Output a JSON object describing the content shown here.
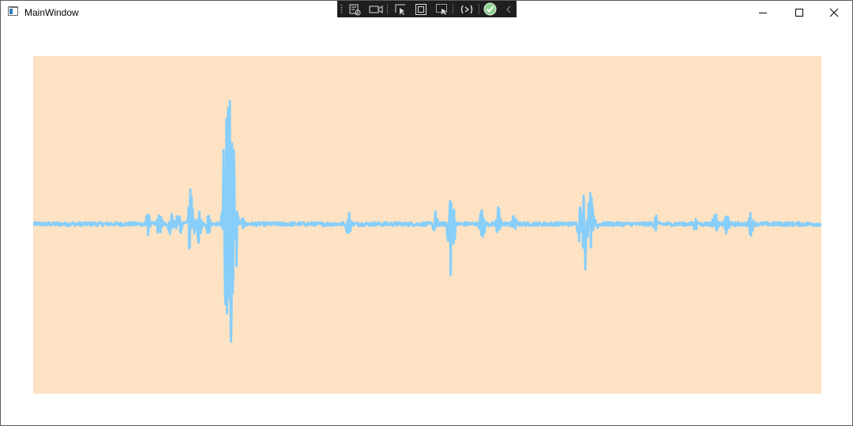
{
  "window": {
    "title": "MainWindow"
  },
  "caption_buttons": {
    "minimize_icon": "minimize-icon",
    "maximize_icon": "maximize-icon",
    "close_icon": "close-icon"
  },
  "debug_toolbar": {
    "items": [
      "live-visual-tree-icon",
      "camera-icon",
      "select-element-icon",
      "display-layout-adorners-icon",
      "track-focus-icon",
      "hot-reload-icon",
      "hot-reload-ok-icon",
      "collapse-chevron-icon"
    ]
  },
  "colors": {
    "plot_background": "#fde3c3",
    "waveform": "#87cefa",
    "window_background": "#ffffff"
  },
  "chart_data": {
    "type": "line",
    "title": "",
    "xlabel": "",
    "ylabel": "",
    "grid": false,
    "legend": "none",
    "ylim": [
      -1,
      1
    ],
    "bursts": [
      {
        "x": 0.145,
        "amp": 0.08
      },
      {
        "x": 0.16,
        "amp": 0.11
      },
      {
        "x": 0.175,
        "amp": 0.14
      },
      {
        "x": 0.185,
        "amp": 0.12
      },
      {
        "x": 0.2,
        "amp": 0.25
      },
      {
        "x": 0.21,
        "amp": 0.14
      },
      {
        "x": 0.222,
        "amp": 0.08
      },
      {
        "x": 0.248,
        "amp": 0.82
      },
      {
        "x": 0.252,
        "amp": 0.78
      },
      {
        "x": 0.244,
        "amp": 0.4
      },
      {
        "x": 0.257,
        "amp": 0.12
      },
      {
        "x": 0.265,
        "amp": 0.04
      },
      {
        "x": 0.4,
        "amp": 0.1
      },
      {
        "x": 0.51,
        "amp": 0.09
      },
      {
        "x": 0.53,
        "amp": 0.38
      },
      {
        "x": 0.57,
        "amp": 0.13
      },
      {
        "x": 0.59,
        "amp": 0.12
      },
      {
        "x": 0.61,
        "amp": 0.08
      },
      {
        "x": 0.7,
        "amp": 0.3
      },
      {
        "x": 0.706,
        "amp": 0.32
      },
      {
        "x": 0.694,
        "amp": 0.14
      },
      {
        "x": 0.715,
        "amp": 0.05
      },
      {
        "x": 0.79,
        "amp": 0.06
      },
      {
        "x": 0.84,
        "amp": 0.05
      },
      {
        "x": 0.865,
        "amp": 0.08
      },
      {
        "x": 0.88,
        "amp": 0.1
      },
      {
        "x": 0.91,
        "amp": 0.08
      }
    ],
    "noise": 0.012
  }
}
